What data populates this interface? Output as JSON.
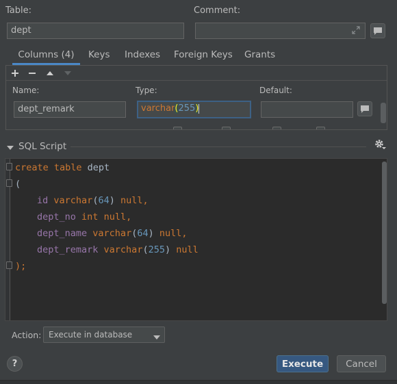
{
  "table": {
    "label": "Table:",
    "value": "dept"
  },
  "comment": {
    "label": "Comment:",
    "value": ""
  },
  "tabs": [
    {
      "label": "Columns (4)",
      "active": true
    },
    {
      "label": "Keys"
    },
    {
      "label": "Indexes"
    },
    {
      "label": "Foreign Keys"
    },
    {
      "label": "Grants"
    }
  ],
  "column_editor": {
    "name_label": "Name:",
    "name_value": "dept_remark",
    "type_label": "Type:",
    "type_value": {
      "base": "varchar",
      "open": "(",
      "num": "255",
      "close": ")"
    },
    "default_label": "Default:",
    "default_value": ""
  },
  "sql_script": {
    "label": "SQL Script",
    "lines": {
      "l1": {
        "kw": "create table ",
        "name": "dept"
      },
      "l2": "(",
      "l3": {
        "col": "id",
        "type": "varchar",
        "p1": "(",
        "n": "64",
        "p2": ")",
        "tail": " null,"
      },
      "l4": {
        "col": "dept_no",
        "type": "int",
        "tail": " null,"
      },
      "l5": {
        "col": "dept_name",
        "type": "varchar",
        "p1": "(",
        "n": "64",
        "p2": ")",
        "tail": " null,"
      },
      "l6": {
        "col": "dept_remark",
        "type": "varchar",
        "p1": "(",
        "n": "255",
        "p2": ")",
        "tail": " null"
      },
      "l7": ");"
    }
  },
  "action": {
    "label": "Action:",
    "selected": "Execute in database"
  },
  "buttons": {
    "execute": "Execute",
    "cancel": "Cancel",
    "help": "?"
  },
  "colors": {
    "background": "#3c3f41",
    "editor": "#2b2b2b",
    "keyword": "#cc7832",
    "identifier": "#9876aa",
    "number": "#6897bb",
    "primary_button": "#365880",
    "focus_border": "#3d6185"
  }
}
